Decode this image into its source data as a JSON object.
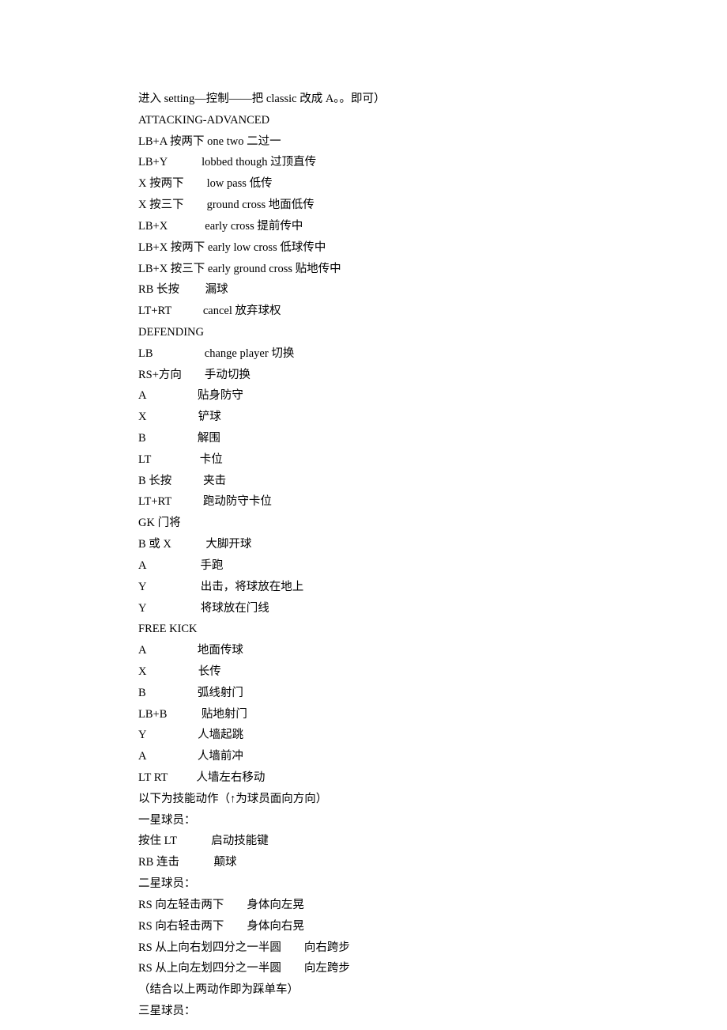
{
  "lines": [
    "进入 setting—控制——把 classic 改成 A。。即可）",
    "ATTACKING-ADVANCED",
    "LB+A 按两下 one two 二过一",
    "LB+Y            lobbed though 过顶直传",
    "X 按两下        low pass 低传",
    "X 按三下        ground cross 地面低传",
    "LB+X             early cross 提前传中",
    "LB+X 按两下 early low cross 低球传中",
    "LB+X 按三下 early ground cross 贴地传中",
    "RB 长按         漏球",
    "LT+RT           cancel 放弃球权",
    "DEFENDING",
    "LB                  change player 切换",
    "RS+方向        手动切换",
    "A                  贴身防守",
    "X                  铲球",
    "B                  解围",
    "LT                 卡位",
    "B 长按           夹击",
    "LT+RT           跑动防守卡位",
    "GK 门将",
    "B 或 X            大脚开球",
    "A                   手跑",
    "Y                   出击，将球放在地上",
    "Y                   将球放在门线",
    "FREE KICK",
    "A                  地面传球",
    "X                  长传",
    "B                  弧线射门",
    "LB+B            贴地射门",
    "Y                  人墙起跳",
    "A                  人墙前冲",
    "LT RT          人墙左右移动",
    "以下为技能动作（↑为球员面向方向）",
    "一星球员：",
    "按住 LT            启动技能键",
    "RB 连击            颠球",
    "二星球员：",
    "RS 向左轻击两下        身体向左晃",
    "RS 向右轻击两下        身体向右晃",
    "RS 从上向右划四分之一半圆        向右跨步",
    "RS 从上向左划四分之一半圆        向左跨步",
    "（结合以上两动作即为踩单车）",
    "三星球员："
  ]
}
